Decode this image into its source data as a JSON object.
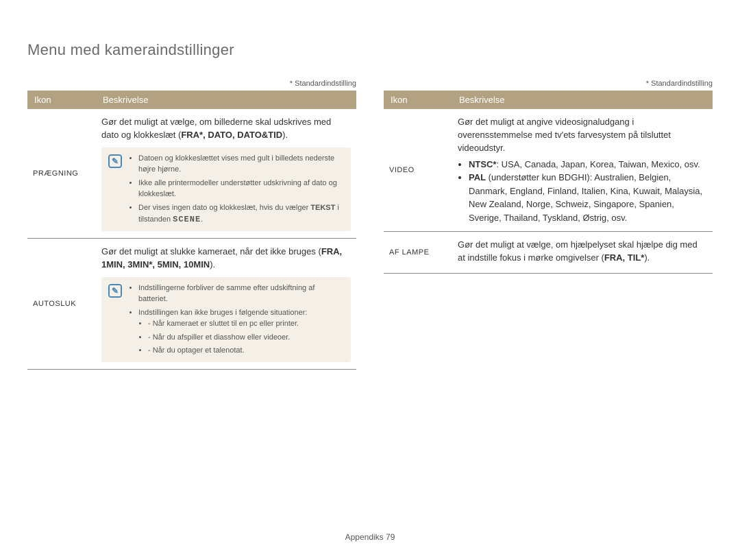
{
  "page_title": "Menu med kameraindstillinger",
  "default_note": "* Standardindstilling",
  "table_headers": {
    "icon": "Ikon",
    "desc": "Beskrivelse"
  },
  "left": {
    "rows": [
      {
        "icon": "PRÆGNING",
        "main_pre": "Gør det muligt at vælge, om billederne skal udskrives med dato og klokkeslæt (",
        "opts": "FRA*, DATO, DATO&TID",
        "main_post": ").",
        "notes": [
          "Datoen og klokkeslættet vises med gult i billedets nederste højre hjørne.",
          "Ikke alle printermodeller understøtter udskrivning af dato og klokkeslæt."
        ],
        "note_tekst_pre": "Der vises ingen dato og klokkeslæt, hvis du vælger ",
        "note_tekst_bold": "TEKST",
        "note_tekst_mid": " i tilstanden ",
        "note_tekst_scene": "SCENE",
        "note_tekst_post": "."
      },
      {
        "icon": "AUTOSLUK",
        "main_pre": "Gør det muligt at slukke kameraet, når det ikke bruges (",
        "opts": "FRA, 1MIN, 3MIN*, 5MIN, 10MIN",
        "main_post": ").",
        "note1": "Indstillingerne forbliver de samme efter udskiftning af batteriet.",
        "note2": "Indstillingen kan ikke bruges i følgende situationer:",
        "sub": [
          "Når kameraet er sluttet til en pc eller printer.",
          "Når du afspiller et diasshow eller videoer.",
          "Når du optager et talenotat."
        ]
      }
    ]
  },
  "right": {
    "rows": [
      {
        "icon": "VIDEO",
        "main": "Gør det muligt at angive videosignaludgang i overensstemmelse med tv'ets farvesystem på tilsluttet videoudstyr.",
        "ntsc_label": "NTSC*",
        "ntsc_text": ": USA, Canada, Japan, Korea, Taiwan, Mexico, osv.",
        "pal_label": "PAL",
        "pal_paren": " (understøtter kun BDGHI)",
        "pal_text": ": Australien, Belgien, Danmark, England, Finland, Italien, Kina, Kuwait, Malaysia, New Zealand, Norge, Schweiz, Singapore, Spanien, Sverige, Thailand, Tyskland, Østrig, osv."
      },
      {
        "icon": "AF LAMPE",
        "main_pre": "Gør det muligt at vælge, om hjælpelyset skal hjælpe dig med at indstille fokus i mørke omgivelser (",
        "opts": "FRA, TIL*",
        "main_post": ")."
      }
    ]
  },
  "footer": {
    "label": "Appendiks",
    "page": "79"
  }
}
